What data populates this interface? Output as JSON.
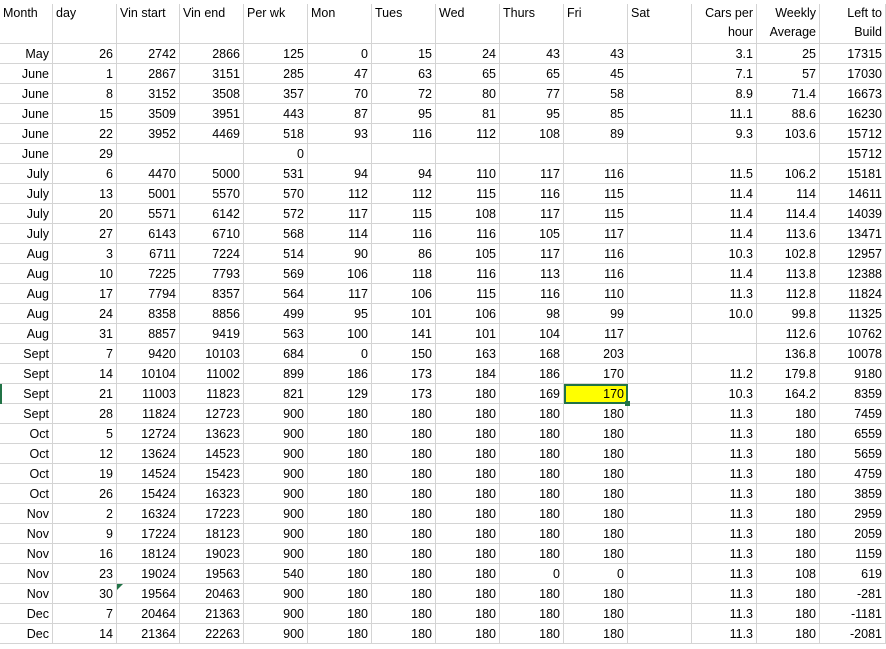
{
  "colors": {
    "highlight": "#ffff00",
    "selection": "#217346",
    "gridline": "#d4d4d4"
  },
  "headers": {
    "month": "Month",
    "day": "day",
    "vin_start": "Vin start",
    "vin_end": "Vin end",
    "per_wk": "Per wk",
    "mon": "Mon",
    "tues": "Tues",
    "wed": "Wed",
    "thurs": "Thurs",
    "fri": "Fri",
    "sat": "Sat",
    "cars_per_hour": [
      "Cars per",
      "hour"
    ],
    "weekly_average": [
      "Weekly",
      "Average"
    ],
    "left_to_build": [
      "Left to",
      "Build"
    ]
  },
  "rows": [
    [
      "May",
      "26",
      "2742",
      "2866",
      "125",
      "0",
      "15",
      "24",
      "43",
      "43",
      "",
      "3.1",
      "25",
      "17315"
    ],
    [
      "June",
      "1",
      "2867",
      "3151",
      "285",
      "47",
      "63",
      "65",
      "65",
      "45",
      "",
      "7.1",
      "57",
      "17030"
    ],
    [
      "June",
      "8",
      "3152",
      "3508",
      "357",
      "70",
      "72",
      "80",
      "77",
      "58",
      "",
      "8.9",
      "71.4",
      "16673"
    ],
    [
      "June",
      "15",
      "3509",
      "3951",
      "443",
      "87",
      "95",
      "81",
      "95",
      "85",
      "",
      "11.1",
      "88.6",
      "16230"
    ],
    [
      "June",
      "22",
      "3952",
      "4469",
      "518",
      "93",
      "116",
      "112",
      "108",
      "89",
      "",
      "9.3",
      "103.6",
      "15712"
    ],
    [
      "June",
      "29",
      "",
      "",
      "0",
      "",
      "",
      "",
      "",
      "",
      "",
      "",
      "",
      "15712"
    ],
    [
      "July",
      "6",
      "4470",
      "5000",
      "531",
      "94",
      "94",
      "110",
      "117",
      "116",
      "",
      "11.5",
      "106.2",
      "15181"
    ],
    [
      "July",
      "13",
      "5001",
      "5570",
      "570",
      "112",
      "112",
      "115",
      "116",
      "115",
      "",
      "11.4",
      "114",
      "14611"
    ],
    [
      "July",
      "20",
      "5571",
      "6142",
      "572",
      "117",
      "115",
      "108",
      "117",
      "115",
      "",
      "11.4",
      "114.4",
      "14039"
    ],
    [
      "July",
      "27",
      "6143",
      "6710",
      "568",
      "114",
      "116",
      "116",
      "105",
      "117",
      "",
      "11.4",
      "113.6",
      "13471"
    ],
    [
      "Aug",
      "3",
      "6711",
      "7224",
      "514",
      "90",
      "86",
      "105",
      "117",
      "116",
      "",
      "10.3",
      "102.8",
      "12957"
    ],
    [
      "Aug",
      "10",
      "7225",
      "7793",
      "569",
      "106",
      "118",
      "116",
      "113",
      "116",
      "",
      "11.4",
      "113.8",
      "12388"
    ],
    [
      "Aug",
      "17",
      "7794",
      "8357",
      "564",
      "117",
      "106",
      "115",
      "116",
      "110",
      "",
      "11.3",
      "112.8",
      "11824"
    ],
    [
      "Aug",
      "24",
      "8358",
      "8856",
      "499",
      "95",
      "101",
      "106",
      "98",
      "99",
      "",
      "10.0",
      "99.8",
      "11325"
    ],
    [
      "Aug",
      "31",
      "8857",
      "9419",
      "563",
      "100",
      "141",
      "101",
      "104",
      "117",
      "",
      "",
      "112.6",
      "10762"
    ],
    [
      "Sept",
      "7",
      "9420",
      "10103",
      "684",
      "0",
      "150",
      "163",
      "168",
      "203",
      "",
      "",
      "136.8",
      "10078"
    ],
    [
      "Sept",
      "14",
      "10104",
      "11002",
      "899",
      "186",
      "173",
      "184",
      "186",
      "170",
      "",
      "11.2",
      "179.8",
      "9180"
    ],
    [
      "Sept",
      "21",
      "11003",
      "11823",
      "821",
      "129",
      "173",
      "180",
      "169",
      "170",
      "",
      "10.3",
      "164.2",
      "8359"
    ],
    [
      "Sept",
      "28",
      "11824",
      "12723",
      "900",
      "180",
      "180",
      "180",
      "180",
      "180",
      "",
      "11.3",
      "180",
      "7459"
    ],
    [
      "Oct",
      "5",
      "12724",
      "13623",
      "900",
      "180",
      "180",
      "180",
      "180",
      "180",
      "",
      "11.3",
      "180",
      "6559"
    ],
    [
      "Oct",
      "12",
      "13624",
      "14523",
      "900",
      "180",
      "180",
      "180",
      "180",
      "180",
      "",
      "11.3",
      "180",
      "5659"
    ],
    [
      "Oct",
      "19",
      "14524",
      "15423",
      "900",
      "180",
      "180",
      "180",
      "180",
      "180",
      "",
      "11.3",
      "180",
      "4759"
    ],
    [
      "Oct",
      "26",
      "15424",
      "16323",
      "900",
      "180",
      "180",
      "180",
      "180",
      "180",
      "",
      "11.3",
      "180",
      "3859"
    ],
    [
      "Nov",
      "2",
      "16324",
      "17223",
      "900",
      "180",
      "180",
      "180",
      "180",
      "180",
      "",
      "11.3",
      "180",
      "2959"
    ],
    [
      "Nov",
      "9",
      "17224",
      "18123",
      "900",
      "180",
      "180",
      "180",
      "180",
      "180",
      "",
      "11.3",
      "180",
      "2059"
    ],
    [
      "Nov",
      "16",
      "18124",
      "19023",
      "900",
      "180",
      "180",
      "180",
      "180",
      "180",
      "",
      "11.3",
      "180",
      "1159"
    ],
    [
      "Nov",
      "23",
      "19024",
      "19563",
      "540",
      "180",
      "180",
      "180",
      "0",
      "0",
      "",
      "11.3",
      "108",
      "619"
    ],
    [
      "Nov",
      "30",
      "19564",
      "20463",
      "900",
      "180",
      "180",
      "180",
      "180",
      "180",
      "",
      "11.3",
      "180",
      "-281"
    ],
    [
      "Dec",
      "7",
      "20464",
      "21363",
      "900",
      "180",
      "180",
      "180",
      "180",
      "180",
      "",
      "11.3",
      "180",
      "-1181"
    ],
    [
      "Dec",
      "14",
      "21364",
      "22263",
      "900",
      "180",
      "180",
      "180",
      "180",
      "180",
      "",
      "11.3",
      "180",
      "-2081"
    ]
  ]
}
